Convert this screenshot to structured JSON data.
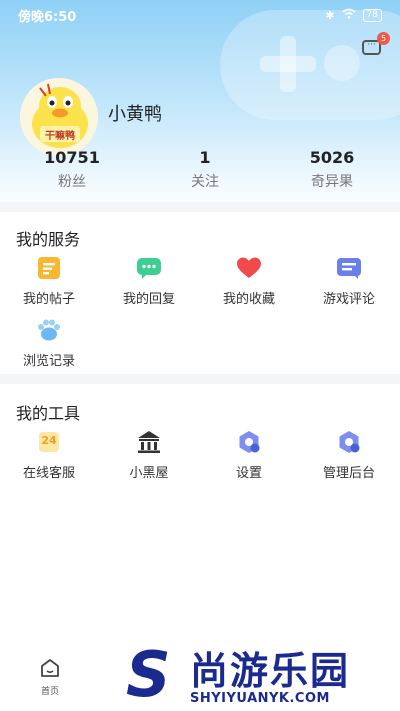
{
  "status_bar": {
    "time": "傍晚6:50",
    "battery": "78"
  },
  "header": {
    "message_badge": "5"
  },
  "profile": {
    "username": "小黄鸭",
    "avatar_caption": "干嘛鸭"
  },
  "stats": [
    {
      "value": "10751",
      "label": "粉丝"
    },
    {
      "value": "1",
      "label": "关注"
    },
    {
      "value": "5026",
      "label": "奇异果"
    }
  ],
  "services": {
    "title": "我的服务",
    "items": [
      {
        "label": "我的帖子",
        "icon": "posts-icon"
      },
      {
        "label": "我的回复",
        "icon": "reply-icon"
      },
      {
        "label": "我的收藏",
        "icon": "heart-icon"
      },
      {
        "label": "游戏评论",
        "icon": "comment-icon"
      },
      {
        "label": "浏览记录",
        "icon": "paw-icon"
      }
    ]
  },
  "tools": {
    "title": "我的工具",
    "items": [
      {
        "label": "在线客服",
        "icon": "support-24-icon",
        "icon_text": "24"
      },
      {
        "label": "小黑屋",
        "icon": "building-icon"
      },
      {
        "label": "设置",
        "icon": "settings-icon"
      },
      {
        "label": "管理后台",
        "icon": "admin-icon"
      }
    ]
  },
  "tab_bar": {
    "home_label": "首页"
  },
  "watermark": {
    "brand": "尚游乐园",
    "url": "SHYIYUANYK.COM"
  },
  "colors": {
    "header_top": "#8fd0f6",
    "badge": "#f15a4a",
    "watermark": "#1b2a8f"
  }
}
